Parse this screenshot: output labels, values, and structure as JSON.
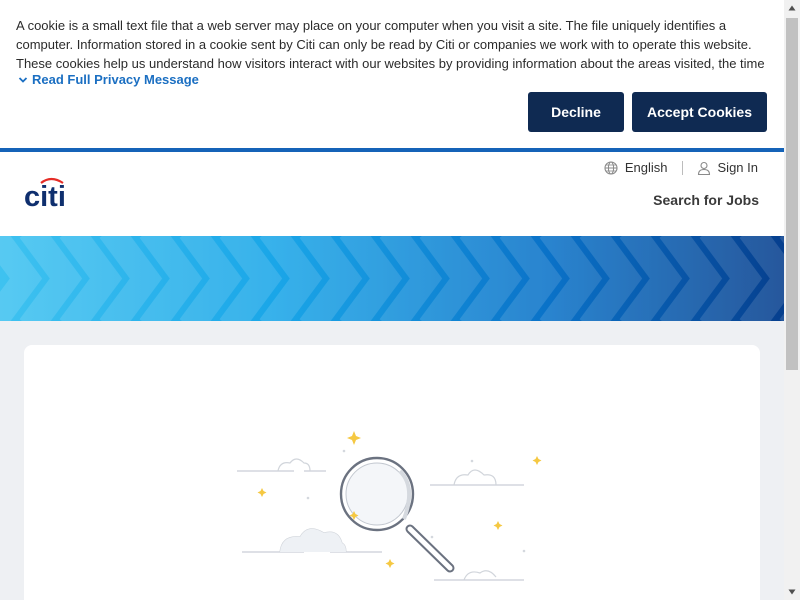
{
  "cookie_banner": {
    "text": "A cookie is a small text file that a web server may place on your computer when you visit a site. The file uniquely identifies a computer. Information stored in a cookie sent by Citi can only be read by Citi or companies we work with to operate this website. These cookies help us understand how visitors interact with our websites by providing information about the areas visited, the time spent on the website and any …",
    "read_more_label": "Read Full Privacy Message",
    "decline_label": "Decline",
    "accept_label": "Accept Cookies"
  },
  "header": {
    "logo_text": "citi",
    "language_label": "English",
    "signin_label": "Sign In",
    "search_jobs_label": "Search for Jobs"
  },
  "colors": {
    "brand_navy": "#0f2a52",
    "link_blue": "#1b6fc2",
    "rule_blue": "#1563b8",
    "logo_red": "#e52d27"
  },
  "icons": {
    "language": "globe-icon",
    "signin": "user-icon",
    "read_more": "chevron-down-icon",
    "illustration": "magnifying-glass-icon"
  }
}
